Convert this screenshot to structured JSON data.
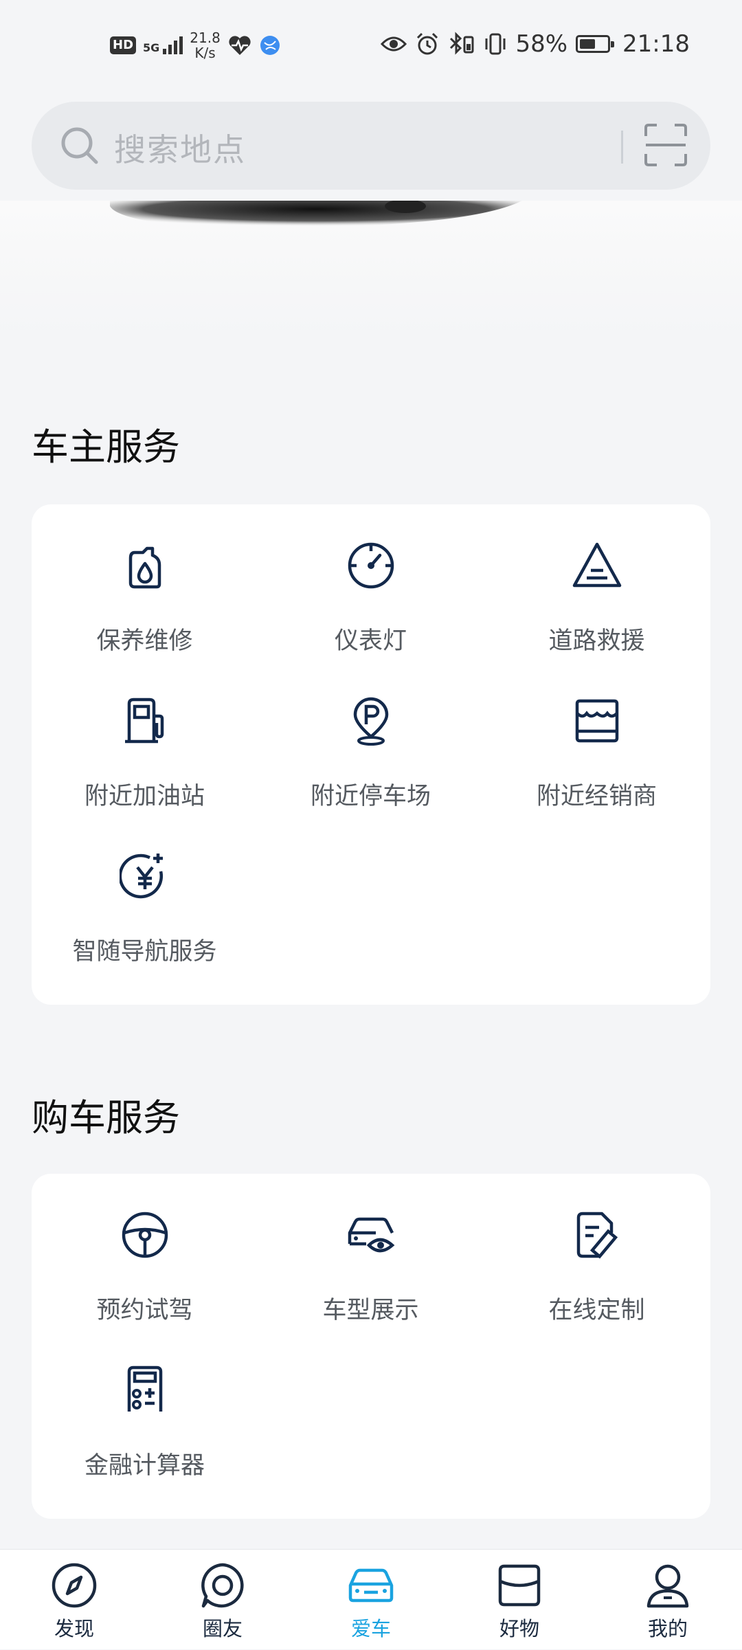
{
  "status_bar": {
    "hd": "HD",
    "network": "5G",
    "speed_value": "21.8",
    "speed_unit": "K/s",
    "battery_percent": "58%",
    "battery_level": 0.58,
    "time": "21:18",
    "icons": [
      "heart-rate-icon",
      "globe-app-icon",
      "eye-icon",
      "alarm-icon",
      "bluetooth-icon",
      "vibrate-icon"
    ]
  },
  "search": {
    "placeholder": "搜索地点"
  },
  "owner_services": {
    "title": "车主服务",
    "items": [
      {
        "label": "保养维修",
        "icon": "oil-bottle-icon"
      },
      {
        "label": "仪表灯",
        "icon": "gauge-icon"
      },
      {
        "label": "道路救援",
        "icon": "traffic-cone-icon"
      },
      {
        "label": "附近加油站",
        "icon": "fuel-pump-icon"
      },
      {
        "label": "附近停车场",
        "icon": "parking-pin-icon"
      },
      {
        "label": "附近经销商",
        "icon": "store-icon"
      },
      {
        "label": "智随导航服务",
        "icon": "yuan-plus-icon"
      }
    ]
  },
  "purchase_services": {
    "title": "购车服务",
    "items": [
      {
        "label": "预约试驾",
        "icon": "steering-wheel-icon"
      },
      {
        "label": "车型展示",
        "icon": "car-eye-icon"
      },
      {
        "label": "在线定制",
        "icon": "document-ruler-icon"
      },
      {
        "label": "金融计算器",
        "icon": "calculator-icon"
      }
    ]
  },
  "bottom_nav": {
    "active_index": 2,
    "active_color": "#1aa3e0",
    "items": [
      {
        "label": "发现",
        "icon": "compass-icon"
      },
      {
        "label": "圈友",
        "icon": "chat-circle-icon"
      },
      {
        "label": "爱车",
        "icon": "car-icon"
      },
      {
        "label": "好物",
        "icon": "bag-icon"
      },
      {
        "label": "我的",
        "icon": "person-icon"
      }
    ]
  },
  "colors": {
    "icon_navy": "#13294b",
    "background": "#f4f5f7",
    "card": "#ffffff"
  }
}
